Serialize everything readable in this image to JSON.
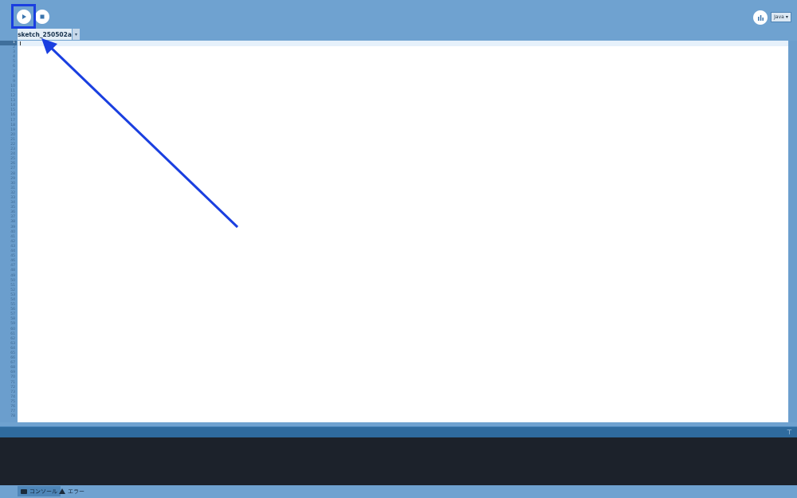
{
  "toolbar": {
    "run_icon": "play-icon",
    "stop_icon": "stop-icon",
    "debug_icon": "debugger-icon",
    "mode_label": "Java",
    "mode_icon": "chevron-down-icon"
  },
  "tabs": [
    {
      "label": "sketch_250502a",
      "menu_icon": "chevron-down-icon"
    }
  ],
  "editor": {
    "line_numbers": [
      "1",
      "2",
      "3",
      "4",
      "5",
      "6",
      "7",
      "8",
      "9",
      "10",
      "11",
      "12",
      "13",
      "14",
      "15",
      "16",
      "17",
      "18",
      "19",
      "20",
      "21",
      "22",
      "23",
      "24",
      "25",
      "26",
      "27",
      "28",
      "29",
      "30",
      "31",
      "32",
      "33",
      "34",
      "35",
      "36",
      "37",
      "38",
      "39",
      "40",
      "41",
      "42",
      "43",
      "44",
      "45",
      "46",
      "47",
      "48",
      "49",
      "50",
      "51",
      "52",
      "53",
      "54",
      "55",
      "56",
      "57",
      "58",
      "59",
      "60",
      "61",
      "62",
      "63",
      "64",
      "65",
      "66",
      "67",
      "68",
      "69",
      "70",
      "71",
      "72",
      "73",
      "74",
      "75",
      "76",
      "77",
      "78"
    ],
    "content": ""
  },
  "bottom_tabs": [
    {
      "label": "コンソール",
      "icon": "console-icon",
      "active": true
    },
    {
      "label": "エラー",
      "icon": "warning-icon",
      "active": false
    }
  ],
  "annotation": {
    "highlight_color": "#1a3fe0"
  },
  "colors": {
    "accent": "#6fa2d0",
    "console_bg": "#1c222b",
    "editor_bg": "#ffffff"
  }
}
